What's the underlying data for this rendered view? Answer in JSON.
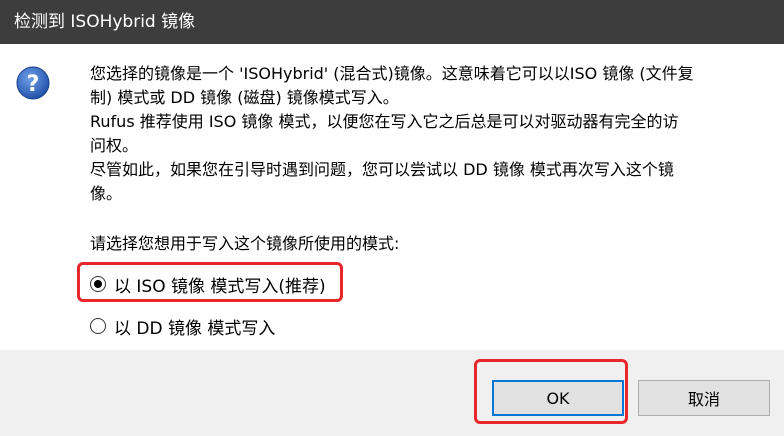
{
  "window": {
    "title": "检测到 ISOHybrid 镜像"
  },
  "icon": {
    "name": "question-icon",
    "glyph": "?",
    "color": "#2a5bb6"
  },
  "message": {
    "line1": "您选择的镜像是一个 'ISOHybrid' (混合式)镜像。这意味着它可以以ISO 镜像 (文件复",
    "line2": "制) 模式或 DD 镜像 (磁盘) 镜像模式写入。",
    "line3": "Rufus 推荐使用 ISO 镜像 模式，以便您在写入它之后总是可以对驱动器有完全的访",
    "line4": "问权。",
    "line5": "尽管如此，如果您在引导时遇到问题，您可以尝试以 DD 镜像 模式再次写入这个镜",
    "line6": "像。"
  },
  "prompt": "请选择您想用于写入这个镜像所使用的模式:",
  "options": [
    {
      "label": "以 ISO 镜像 模式写入(推荐)",
      "selected": true
    },
    {
      "label": "以 DD 镜像 模式写入",
      "selected": false
    }
  ],
  "buttons": {
    "ok": "OK",
    "cancel": "取消"
  },
  "colors": {
    "highlight": "#e8262b",
    "titlebar": "#3d3d3d",
    "focus": "#0078d7"
  }
}
